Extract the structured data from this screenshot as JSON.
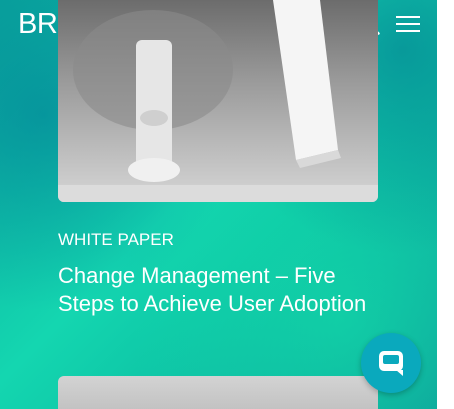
{
  "header": {
    "logo_text": "BRISTLECONE",
    "search_icon": "search-icon",
    "menu_icon": "hamburger-menu-icon"
  },
  "article": {
    "category": "WHITE PAPER",
    "title": "Change Management – Five Steps to Achieve User Adoption"
  },
  "chat_widget": {
    "icon": "chat-bubble-icon",
    "color": "#0aa9bd"
  },
  "colors": {
    "background_teal": "#14d6b0",
    "background_deep": "#0a8fa0",
    "text": "#ffffff"
  }
}
